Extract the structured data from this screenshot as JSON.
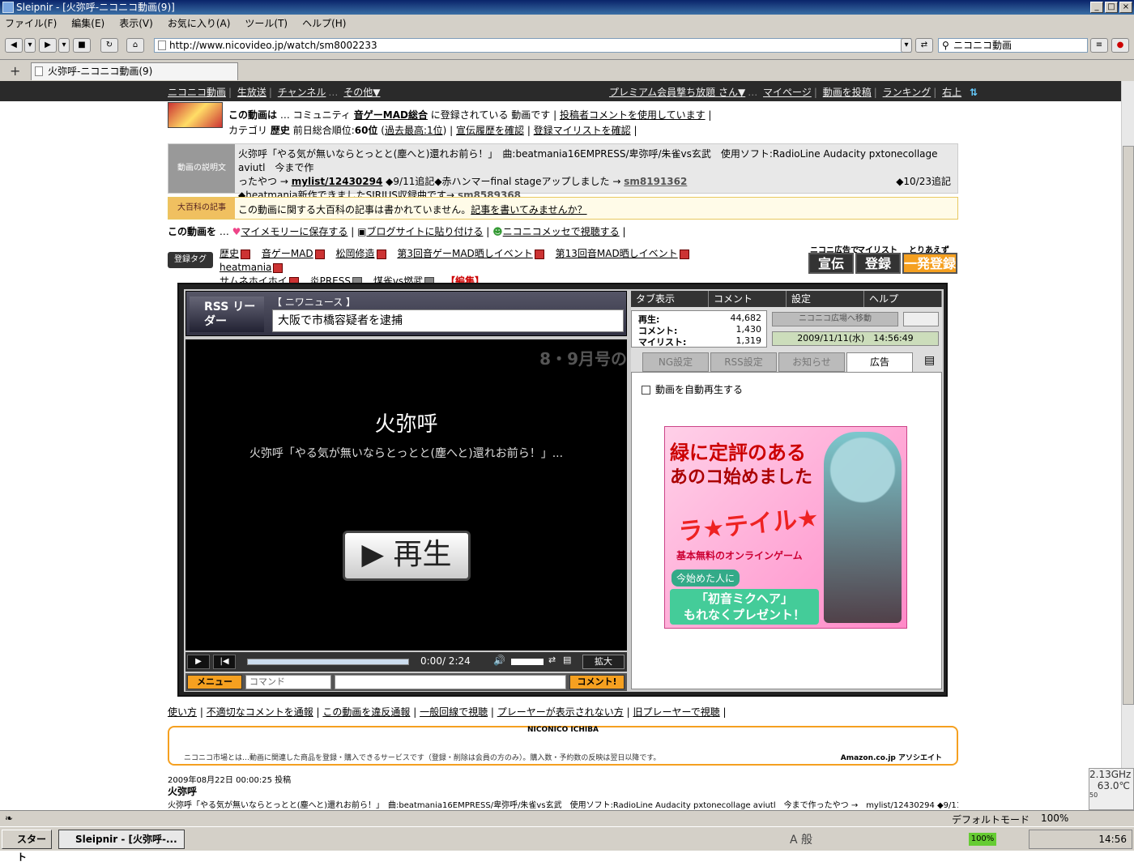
{
  "window": {
    "title": "Sleipnir - [火弥呼-ニコニコ動画(9)]"
  },
  "menu": [
    "ファイル(F)",
    "編集(E)",
    "表示(V)",
    "お気に入り(A)",
    "ツール(T)",
    "ヘルプ(H)"
  ],
  "address": {
    "url": "http://www.nicovideo.jp/watch/sm8002233"
  },
  "search": {
    "value": "ニコニコ動画"
  },
  "tab": {
    "title": "火弥呼-ニコニコ動画(9)"
  },
  "nico_header": {
    "left": [
      "ニコニコ動画",
      "生放送",
      "チャンネル",
      "その他▼"
    ],
    "right": [
      "プレミアム会員撃ち放題 さん▼",
      "マイページ",
      "動画を投稿",
      "ランキング",
      "右上"
    ]
  },
  "info": {
    "line1_prefix": "この動画は",
    "line1_mid": "コミュニティ",
    "community": "音ゲーMAD総合",
    "line1_suffix": "に登録されている 動画です",
    "uploader_comment": "投稿者コメントを使用しています",
    "category_label": "カテゴリ",
    "category": "歴史",
    "rank_text": "前日総合順位:",
    "rank": "60位",
    "past_best": "過去最高:1位",
    "history_link": "宣伝履歴を確認",
    "mylist_link": "登録マイリストを確認"
  },
  "description": {
    "label": "動画の説明文",
    "line1": "火弥呼「やる気が無いならとっとと(塵へと)還れお前ら！」　曲:beatmania16EMPRESS/卑弥呼/朱雀vs玄武　使用ソフト:RadioLine Audacity pxtonecollage aviutl　今まで作",
    "line2a": "ったやつ →",
    "mylist": "mylist/12430294",
    "line2b": "◆9/11追記◆赤ハンマーfinal stageアップしました →",
    "sm1": "sm8191362",
    "line2c": "◆10/23追記",
    "line3a": "◆heatmania新作できましたSIRIUS収録曲です→",
    "sm2": "sm8589368"
  },
  "dic": {
    "label": "大百科の記事",
    "text": "この動画に関する大百科の記事は書かれていません。",
    "link": "記事を書いてみませんか？"
  },
  "actions": {
    "label": "この動画を",
    "save": "マイメモリーに保存する",
    "blog": "ブログサイトに貼り付ける",
    "messe": "ニコニコメッセで視聴する"
  },
  "tags": {
    "label": "登録タグ",
    "row1": [
      "歴史",
      "音ゲーMAD",
      "松岡修造",
      "第3回音ゲーMAD晒しイベント",
      "第13回音MAD晒しイベント",
      "heatmania"
    ],
    "row2": [
      "サムネホイホイ",
      "炎PRESS",
      "煤雀vs燃武"
    ],
    "edit": "【編集】"
  },
  "register": {
    "top1": "ニコニ広告で",
    "top2": "マイリスト",
    "top3": "とりあえず",
    "btn1": "宣伝",
    "btn2": "登録",
    "btn3": "一発登録"
  },
  "rss": {
    "logo": "RSS リーダー",
    "category": "【 ニワニュース 】",
    "headline": "大阪で市橋容疑者を逮捕"
  },
  "video": {
    "title": "火弥呼",
    "desc": "火弥呼「やる気が無いならとっとと(塵へと)還れお前ら！」...",
    "ticker": "8・9月号の",
    "play": "▶ 再生"
  },
  "controls": {
    "time": "0:00/ 2:24",
    "expand": "拡大",
    "menu": "メニュー",
    "command_placeholder": "コマンド",
    "comment_btn": "コメント!"
  },
  "side": {
    "tabs": [
      "タブ表示",
      "コメント",
      "設定",
      "ヘルプ"
    ],
    "stats": {
      "play_label": "再生:",
      "play": "44,682",
      "comment_label": "コメント:",
      "comment": "1,430",
      "mylist_label": "マイリスト:",
      "mylist": "1,319"
    },
    "hiroba": "ニコニコ広場へ移動",
    "clock": "2009/11/11(水)　14:56:49",
    "subtabs": [
      "NG設定",
      "RSS設定",
      "お知らせ",
      "広告"
    ],
    "autoplay": "動画を自動再生する"
  },
  "ad": {
    "line1": "緑に定評のある",
    "line2": "あのコ始めました",
    "logo": "ラ★テイル★",
    "sub": "基本無料のオンラインゲーム",
    "now": "今始めた人に",
    "gift1": "「初音ミクヘア」",
    "gift2": "もれなくプレゼント！"
  },
  "footlinks": [
    "使い方",
    "不適切なコメントを通報",
    "この動画を違反通報",
    "一般回線で視聴",
    "プレーヤーが表示されない方",
    "旧プレーヤーで視聴"
  ],
  "ichiba": {
    "title": "NICONICO ICHIBA",
    "desc": "ニコニコ市場とは…動画に関連した商品を登録・購入できるサービスです（登録・削除は会員の方のみ）。購入数・予約数の反映は翌日以降です。",
    "amazon": "Amazon.co.jp アソシエイト"
  },
  "posted": "2009年08月22日  00:00:25 投稿",
  "video_title": "火弥呼",
  "video_desc": "火弥呼「やる気が無いならとっとと(塵へと)還れお前ら！」　曲:beatmania16EMPRESS/卑弥呼/朱雀vs玄武　使用ソフト:RadioLine Audacity pxtonecollage aviutl　今まで作ったやつ →　mylist/12430294 ◆9/11追記◆赤ハンマー",
  "status": {
    "mode": "デフォルトモード",
    "zoom": "100%"
  },
  "gadget": {
    "cpu": "2.13GHz",
    "temp": "63.0℃",
    "scale": "50"
  },
  "taskbar": {
    "start": "スタート",
    "task": "Sleipnir - [火弥呼-...",
    "battery": "100%",
    "time": "14:56",
    "ime": "A 般"
  }
}
